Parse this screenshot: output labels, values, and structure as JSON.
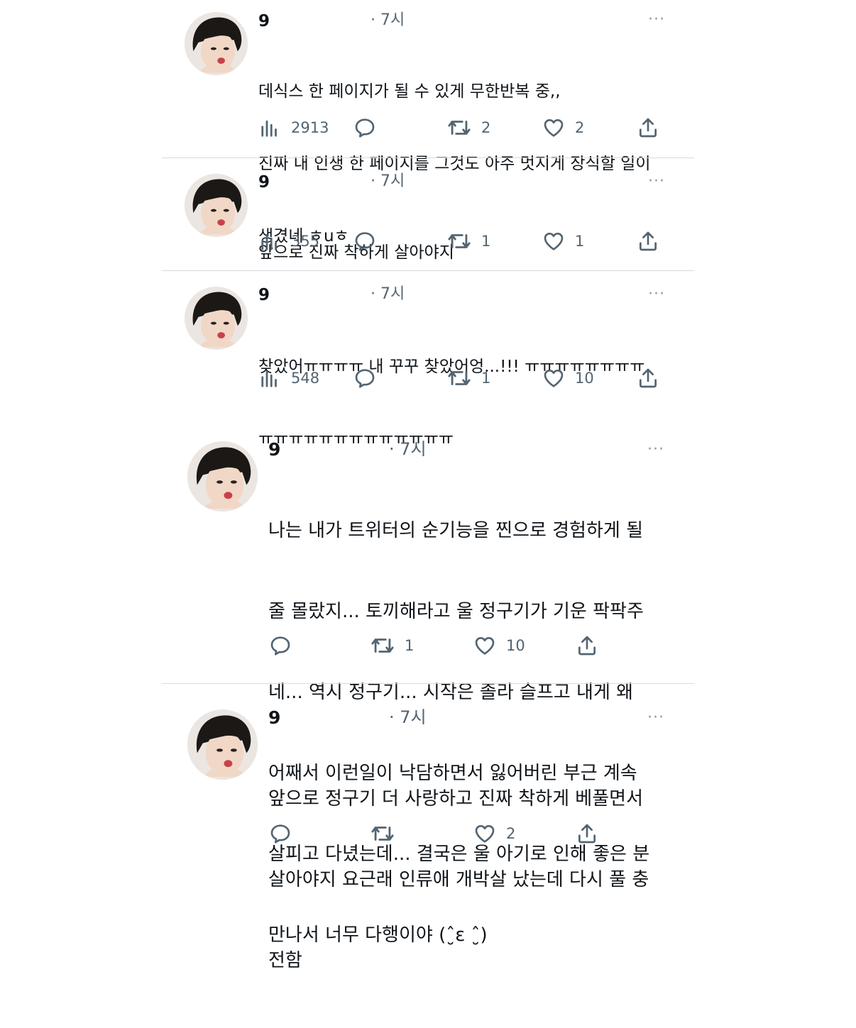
{
  "tweets": [
    {
      "name": "9",
      "time": "· 7시",
      "more": "···",
      "lines": [
        "데식스 한 페이지가 될 수 있게 무한반복 중,,",
        "진짜 내 인생 한 페이지를 그것도 아주 멋지게 장식할 일이",
        "생겼네 ㅎuㅎ"
      ],
      "views": "2913",
      "retweets": "2",
      "likes": "2"
    },
    {
      "name": "9",
      "time": "· 7시",
      "more": "···",
      "lines": [
        "앞으로 진짜 착하게 살아야지"
      ],
      "views": "355",
      "retweets": "1",
      "likes": "1"
    },
    {
      "name": "9",
      "time": "· 7시",
      "more": "···",
      "lines": [
        "찾았어ㅠㅠㅠㅠ 내 꾸꾸 찾았어엉...!!! ㅠㅠㅠㅠㅠㅠㅠㅠ",
        "ㅠㅠㅠㅠㅠㅠㅠㅠㅠㅠㅠㅠㅠ"
      ],
      "views": "548",
      "retweets": "1",
      "likes": "10"
    },
    {
      "name": "9",
      "time": "· 7시",
      "more": "···",
      "lines": [
        "나는 내가 트위터의 순기능을 찐으로 경험하게 될",
        "줄 몰랐지... 토끼해라고 울 정구기가 기운 팍팍주",
        "네... 역시 정구기... 시작은 졸라 슬프고 내게 왜",
        "어째서 이런일이 낙담하면서 잃어버린 부근 계속",
        "살피고 다녔는데... 결국은 울 아기로 인해 좋은 분",
        "만나서 너무 다행이야 (ˆ̮ε ˆ̮)"
      ],
      "retweets": "1",
      "likes": "10"
    },
    {
      "name": "9",
      "time": "· 7시",
      "more": "···",
      "lines": [
        "앞으로 정구기 더 사랑하고 진짜 착하게 베풀면서",
        "살아야지 요근래 인류애 개박살 났는데 다시 풀 충",
        "전함"
      ],
      "likes": "2"
    }
  ],
  "icons": {
    "views": "bar-chart-icon",
    "reply": "speech-bubble-icon",
    "retweet": "retweet-icon",
    "like": "heart-icon",
    "share": "share-upload-icon",
    "more": "more-dots-icon"
  }
}
